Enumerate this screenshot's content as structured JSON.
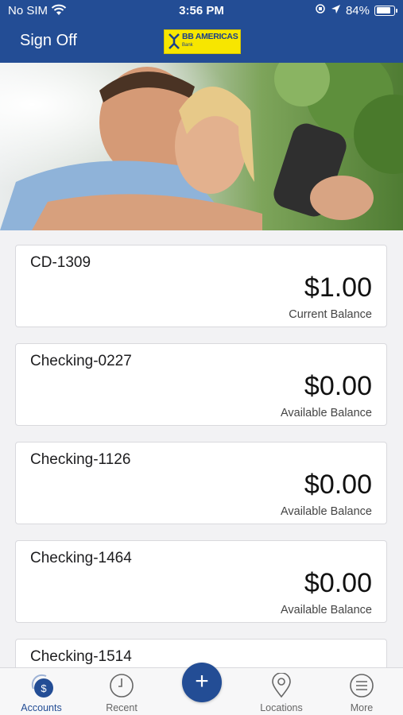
{
  "status_bar": {
    "carrier": "No SIM",
    "time": "3:56 PM",
    "battery": "84%",
    "battery_level": 0.84
  },
  "nav": {
    "sign_off_label": "Sign Off",
    "logo_text": "BB AMERICAS",
    "logo_subtext": "Bank"
  },
  "accounts": [
    {
      "name": "CD-1309",
      "amount": "$1.00",
      "label": "Current Balance"
    },
    {
      "name": "Checking-0227",
      "amount": "$0.00",
      "label": "Available Balance"
    },
    {
      "name": "Checking-1126",
      "amount": "$0.00",
      "label": "Available Balance"
    },
    {
      "name": "Checking-1464",
      "amount": "$0.00",
      "label": "Available Balance"
    },
    {
      "name": "Checking-1514",
      "amount": "",
      "label": ""
    }
  ],
  "tabs": {
    "accounts": "Accounts",
    "recent": "Recent",
    "add": "+",
    "locations": "Locations",
    "more": "More"
  },
  "colors": {
    "brand_blue": "#234d95",
    "logo_yellow": "#f7e600"
  },
  "icons": {
    "wifi": "wifi-icon",
    "location": "location-arrow-icon",
    "battery": "battery-icon",
    "accounts": "dollar-coin-icon",
    "recent": "clock-icon",
    "add": "plus-icon",
    "locations": "map-pin-icon",
    "more": "menu-icon"
  }
}
